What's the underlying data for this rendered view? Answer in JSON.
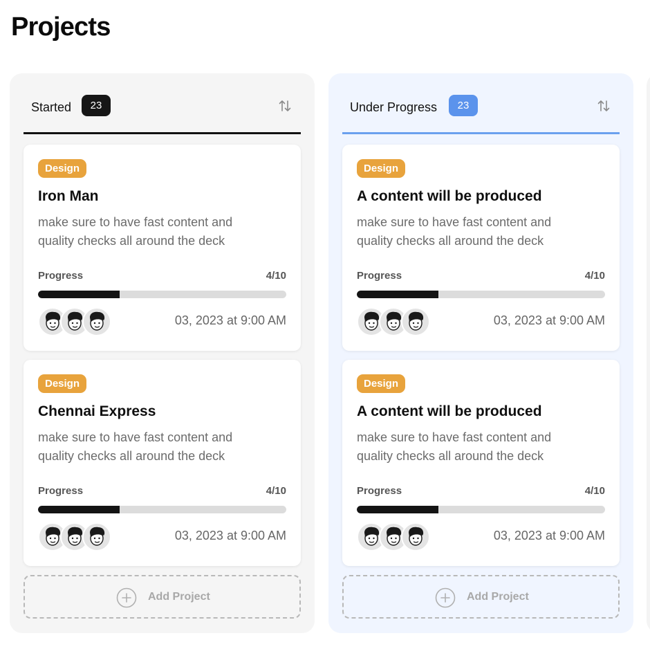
{
  "page": {
    "title": "Projects"
  },
  "colors": {
    "tag_bg": "#e8a33c",
    "started_badge": "#161616",
    "progress_badge": "#5b93ec",
    "started_column_bg": "#f5f5f5",
    "progress_column_bg": "#f0f5ff",
    "progress_fill": "#141414"
  },
  "columns": [
    {
      "title": "Started",
      "count": "23",
      "sort_icon": "sort-arrows-icon",
      "cards": [
        {
          "tag": "Design",
          "title": "Iron Man",
          "description": "make sure to have fast content and quality checks all around the deck",
          "progress_label": "Progress",
          "progress_value": "4/10",
          "progress_fraction": 0.33,
          "date": "03, 2023 at 9:00 AM",
          "avatars": [
            "avatar-icon",
            "avatar-icon",
            "avatar-icon"
          ]
        },
        {
          "tag": "Design",
          "title": "Chennai Express",
          "description": "make sure to have fast content and quality checks all around the deck",
          "progress_label": "Progress",
          "progress_value": "4/10",
          "progress_fraction": 0.33,
          "date": "03, 2023 at 9:00 AM",
          "avatars": [
            "avatar-icon",
            "avatar-icon",
            "avatar-icon"
          ]
        }
      ],
      "add_label": "Add Project"
    },
    {
      "title": "Under Progress",
      "count": "23",
      "sort_icon": "sort-arrows-icon",
      "cards": [
        {
          "tag": "Design",
          "title": "A content will be produced",
          "description": "make sure to have fast content and quality checks all around the deck",
          "progress_label": "Progress",
          "progress_value": "4/10",
          "progress_fraction": 0.33,
          "date": "03, 2023 at 9:00 AM",
          "avatars": [
            "avatar-icon",
            "avatar-icon",
            "avatar-icon"
          ]
        },
        {
          "tag": "Design",
          "title": "A content will be produced",
          "description": "make sure to have fast content and quality checks all around the deck",
          "progress_label": "Progress",
          "progress_value": "4/10",
          "progress_fraction": 0.33,
          "date": "03, 2023 at 9:00 AM",
          "avatars": [
            "avatar-icon",
            "avatar-icon",
            "avatar-icon"
          ]
        }
      ],
      "add_label": "Add Project"
    }
  ]
}
